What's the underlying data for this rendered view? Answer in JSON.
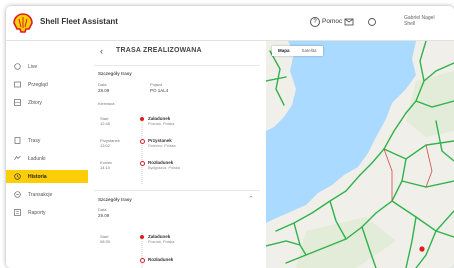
{
  "app": {
    "title": "Shell Fleet Assistant"
  },
  "topbar": {
    "help": "Pomoc",
    "user_name": "Gabriel Nagel",
    "user_sub": "Shell"
  },
  "sidebar": {
    "items": [
      {
        "label": "Live",
        "icon": "live-icon",
        "active": false
      },
      {
        "label": "Przegląd",
        "icon": "overview-icon",
        "active": false
      },
      {
        "label": "Zbiory",
        "icon": "collections-icon",
        "active": false
      },
      {
        "label": "Trasy",
        "icon": "routes-icon",
        "active": false
      },
      {
        "label": "Ładunki",
        "icon": "loads-icon",
        "active": false
      },
      {
        "label": "Historia",
        "icon": "history-icon",
        "active": true
      },
      {
        "label": "Transakcje",
        "icon": "transactions-icon",
        "active": false
      },
      {
        "label": "Raporty",
        "icon": "reports-icon",
        "active": false
      }
    ]
  },
  "panel": {
    "title": "TRASA ZREALIZOWANA",
    "back": "‹",
    "section1": {
      "header": "Szczegóły trasy",
      "f1_label": "Data",
      "f1_value": "28.09",
      "f2_label": "Pojazd",
      "f2_value": "PO 1AL4",
      "f3_label": "Kierowca",
      "stops": [
        {
          "time": "12:45",
          "time2": "Start",
          "name": "Załadunek",
          "addr": "Poznań, Polska",
          "color": "#dd1d21"
        },
        {
          "time": "13:02",
          "time2": "Przystanek",
          "name": "Przystanek",
          "addr": "Gniezno, Polska",
          "color": "#dd1d21"
        },
        {
          "time": "14:10",
          "time2": "Koniec",
          "name": "Rozładunek",
          "addr": "Bydgoszcz, Polska",
          "color": "#dd1d21"
        }
      ]
    },
    "section2": {
      "header": "Szczegóły trasy",
      "f1_label": "Data",
      "f1_value": "29.09",
      "stops": [
        {
          "time": "08:30",
          "time2": "Start",
          "name": "Załadunek",
          "addr": "Poznań, Polska",
          "color": "#dd1d21"
        },
        {
          "time": "",
          "time2": "",
          "name": "Rozładunek",
          "addr": "",
          "color": "#dd1d21"
        }
      ]
    }
  },
  "map": {
    "tab_map": "Mapa",
    "tab_sat": "Satelita"
  },
  "colors": {
    "accent": "#fbce07",
    "brand_red": "#dd1d21",
    "road": "#2fb34a",
    "land": "#f0efe9",
    "water": "#aadaff"
  }
}
